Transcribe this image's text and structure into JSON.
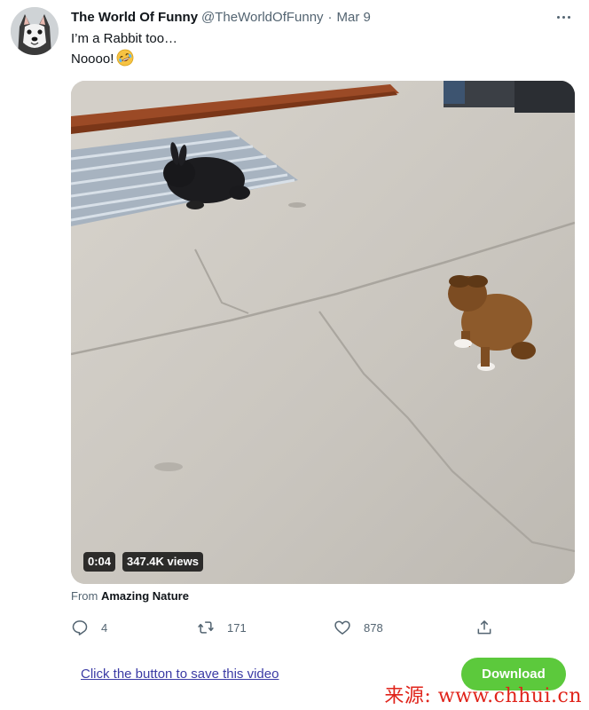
{
  "author": {
    "display_name": "The World Of Funny",
    "handle": "@TheWorldOfFunny",
    "separator": "·",
    "date": "Mar 9"
  },
  "tweet": {
    "line1": "I’m a Rabbit too…",
    "line2": "Noooo!",
    "emoji": "rolling-on-floor-laughing"
  },
  "video": {
    "duration": "0:04",
    "views": "347.4K views"
  },
  "source": {
    "prefix": "From",
    "name": "Amazing Nature"
  },
  "actions": {
    "replies": "4",
    "retweets": "171",
    "likes": "878"
  },
  "save_link": "Click the button to save this video",
  "download_label": "Download",
  "watermark": "来源: www.chhui.cn",
  "colors": {
    "text": "#0f1419",
    "secondary": "#536471",
    "link": "#3b3ba5",
    "download": "#5cc93c",
    "watermark": "#e0241b"
  }
}
